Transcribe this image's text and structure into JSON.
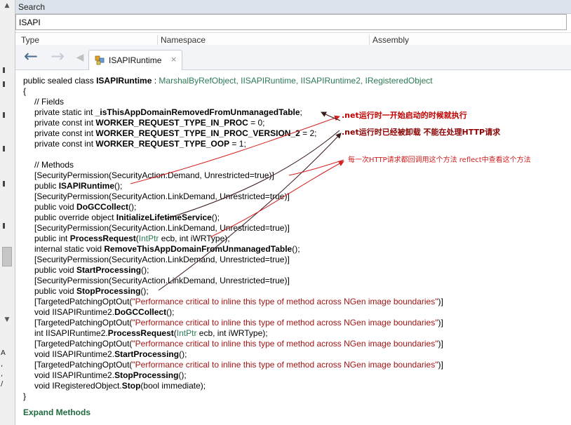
{
  "search": {
    "header_label": "Search",
    "query": "ISAPI",
    "columns": [
      "Type",
      "Namespace",
      "Assembly"
    ]
  },
  "toolbar": {
    "back_icon": "arrow-left-icon",
    "forward_icon": "arrow-right-icon",
    "tab_label": "ISAPIRuntime",
    "tab_close": "×"
  },
  "left_fragments": [
    "A",
    ",",
    ",",
    "/"
  ],
  "code": {
    "decl": {
      "prefix": "public sealed class ",
      "name": "ISAPIRuntime",
      "sep": " : ",
      "bases": "MarshalByRefObject, IISAPIRuntime, IISAPIRuntime2, IRegisteredObject"
    },
    "open_brace": "{",
    "close_brace": "}",
    "fields_comment": "// Fields",
    "fields": [
      {
        "mods": "private static int ",
        "name": "_isThisAppDomainRemovedFromUnmanagedTable",
        "rest": ";"
      },
      {
        "mods": "private const int ",
        "name": "WORKER_REQUEST_TYPE_IN_PROC",
        "rest": " = 0;"
      },
      {
        "mods": "private const int ",
        "name": "WORKER_REQUEST_TYPE_IN_PROC_VERSION_2",
        "rest": " = 2;"
      },
      {
        "mods": "private const int ",
        "name": "WORKER_REQUEST_TYPE_OOP",
        "rest": " = 1;"
      }
    ],
    "methods_comment": "// Methods",
    "attr_demand": "[SecurityPermission(SecurityAction.Demand, Unrestricted=true)]",
    "attr_link": "[SecurityPermission(SecurityAction.LinkDemand, Unrestricted=true)]",
    "attr_patch_open": "[TargetedPatchingOptOut(",
    "attr_patch_str": "\"Performance critical to inline this type of method across NGen image boundaries\"",
    "attr_patch_close": ")]",
    "m_ctor": {
      "mods": "public ",
      "name": "ISAPIRuntime",
      "rest": "();"
    },
    "m_dogc": {
      "mods": "public void ",
      "name": "DoGCCollect",
      "rest": "();"
    },
    "m_init": {
      "mods": "public override object ",
      "name": "InitializeLifetimeService",
      "rest": "();"
    },
    "m_proc": {
      "mods": "public int ",
      "name": "ProcessRequest",
      "args_type": "IntPtr",
      "args_rest": " ecb, int iWRType);"
    },
    "m_remove": {
      "mods": "internal static void ",
      "name": "RemoveThisAppDomainFromUnmanagedTable",
      "rest": "();"
    },
    "m_start": {
      "mods": "public void ",
      "name": "StartProcessing",
      "rest": "();"
    },
    "m_stop": {
      "mods": "public void ",
      "name": "StopProcessing",
      "rest": "();"
    },
    "e_dogc": {
      "mods": "void IISAPIRuntime2.",
      "name": "DoGCCollect",
      "rest": "();"
    },
    "e_proc": {
      "mods": "int IISAPIRuntime2.",
      "name": "ProcessRequest",
      "args_type": "IntPtr",
      "args_rest": " ecb, int iWRType);"
    },
    "e_start": {
      "mods": "void IISAPIRuntime2.",
      "name": "StartProcessing",
      "rest": "();"
    },
    "e_stop": {
      "mods": "void IISAPIRuntime2.",
      "name": "StopProcessing",
      "rest": "();"
    },
    "e_regstop": {
      "mods": "void IRegisteredObject.",
      "name": "Stop",
      "rest": "(bool immediate);"
    }
  },
  "expand_methods": "Expand Methods",
  "annotations": {
    "note1": ".net运行时一开始启动的时候就执行",
    "note2": ".net运行时已经被卸载 不能在处理HTTP请求",
    "note3": "每一次HTTP请求都回调用这个方法 reflect中查看这个方法",
    "colors": {
      "arrow_red": "#d42020",
      "arrow_dark": "#3a1a1a"
    }
  }
}
